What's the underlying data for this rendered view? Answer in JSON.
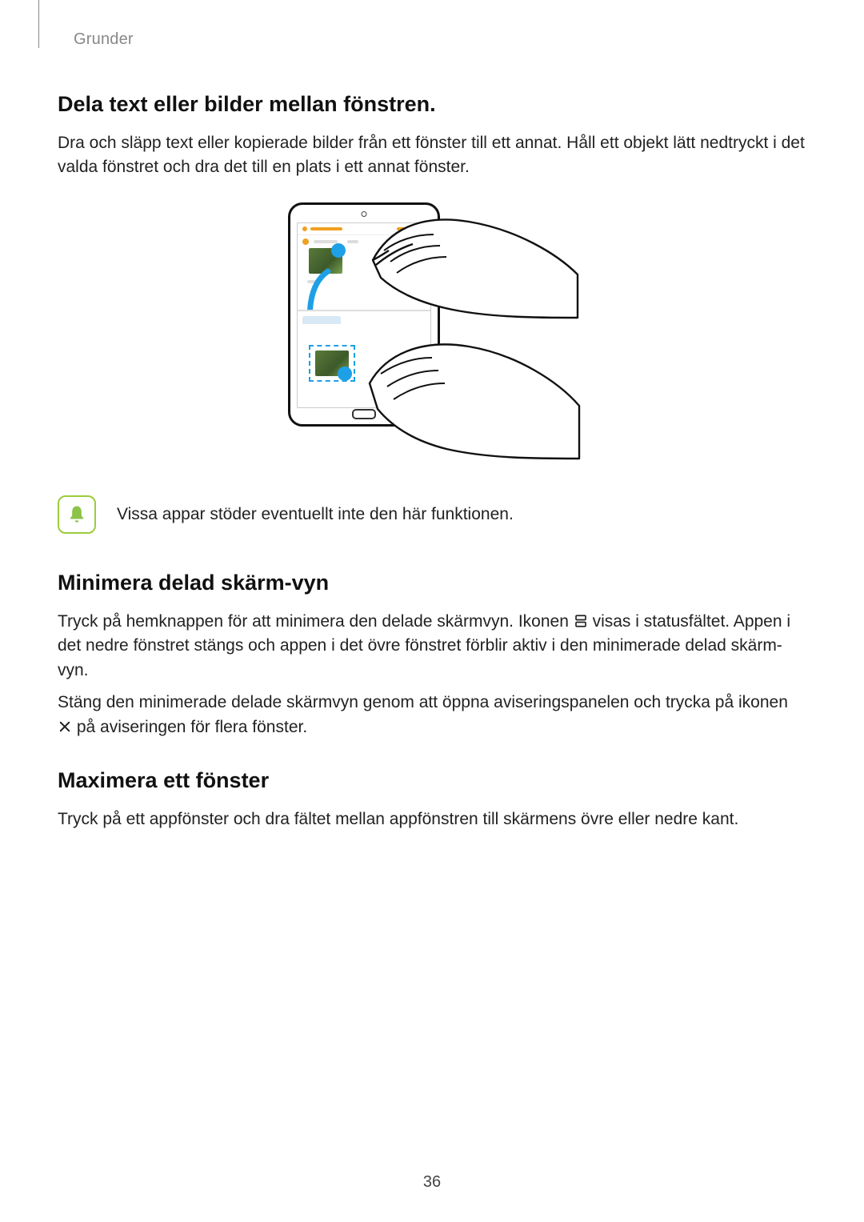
{
  "running_head": "Grunder",
  "sections": {
    "s1": {
      "heading": "Dela text eller bilder mellan fönstren.",
      "p1": "Dra och släpp text eller kopierade bilder från ett fönster till ett annat. Håll ett objekt lätt nedtryckt i det valda fönstret och dra det till en plats i ett annat fönster."
    },
    "note": {
      "text": "Vissa appar stöder eventuellt inte den här funktionen."
    },
    "s2": {
      "heading": "Minimera delad skärm-vyn",
      "p1a": "Tryck på hemknappen för att minimera den delade skärmvyn. Ikonen ",
      "p1b": " visas i statusfältet. Appen i det nedre fönstret stängs och appen i det övre fönstret förblir aktiv i den minimerade delad skärm-vyn.",
      "p2a": "Stäng den minimerade delade skärmvyn genom att öppna aviseringspanelen och trycka på ikonen ",
      "p2b": " på aviseringen för flera fönster."
    },
    "s3": {
      "heading": "Maximera ett fönster",
      "p1": "Tryck på ett appfönster och dra fältet mellan appfönstren till skärmens övre eller nedre kant."
    }
  },
  "page_number": "36"
}
